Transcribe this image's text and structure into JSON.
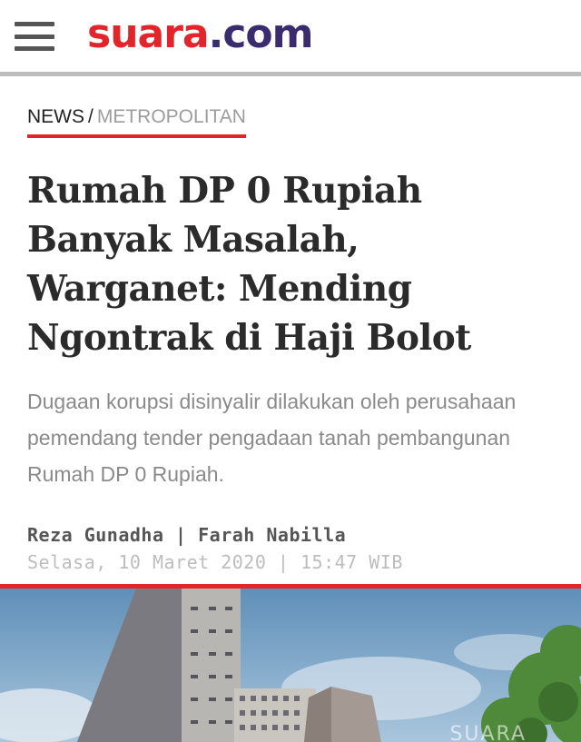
{
  "header": {
    "menu_icon": "hamburger-menu-icon",
    "logo_part1": "suara",
    "logo_part2": ".com",
    "colors": {
      "brand_red": "#e1252b",
      "brand_purple": "#3a2a6e"
    }
  },
  "breadcrumb": {
    "section": "NEWS",
    "separator": "/",
    "subsection": "METROPOLITAN"
  },
  "article": {
    "title": "Rumah DP 0 Rupiah Banyak Masalah, Warganet: Mending Ngontrak di Haji Bolot",
    "summary": "Dugaan korupsi disinyalir dilakukan oleh perusahaan pemendang tender pengadaan tanah pembangunan Rumah DP 0 Rupiah.",
    "authors": "Reza Gunadha | Farah Nabilla",
    "date": "Selasa, 10 Maret 2020 | 15:47 WIB"
  },
  "photo": {
    "watermark": "SUARA"
  }
}
